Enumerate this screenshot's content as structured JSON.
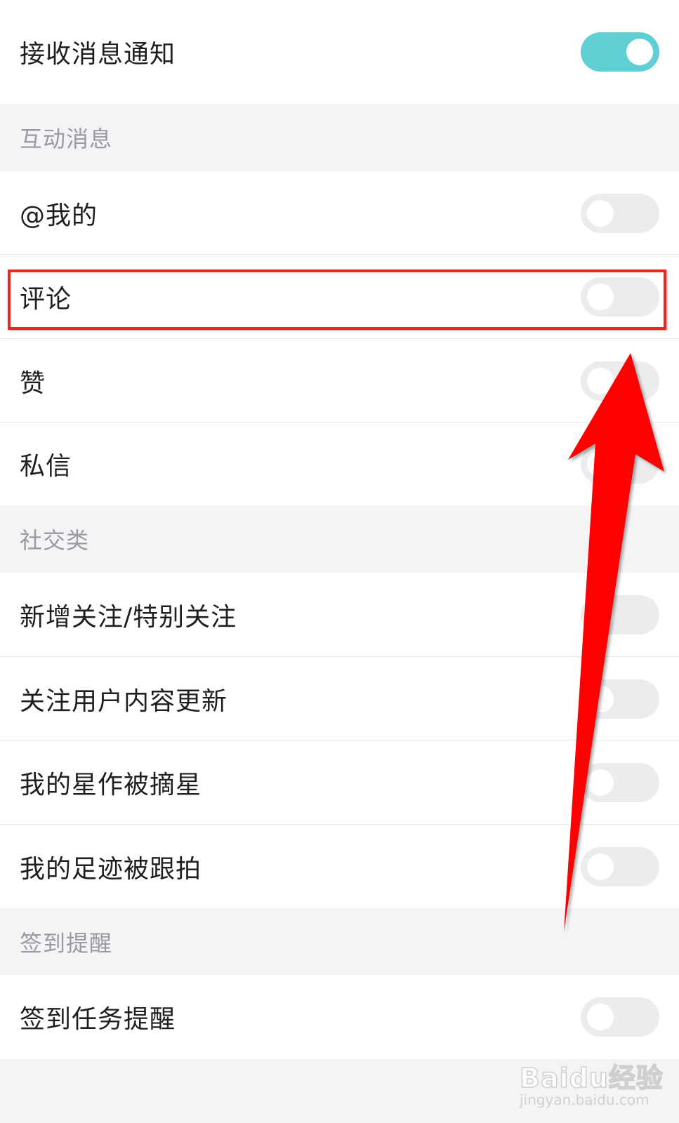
{
  "master_toggle": {
    "label": "接收消息通知",
    "on": true
  },
  "sections": [
    {
      "title": "互动消息",
      "items": [
        {
          "label": "@我的",
          "on": false
        },
        {
          "label": "评论",
          "on": false
        },
        {
          "label": "赞",
          "on": false
        },
        {
          "label": "私信",
          "on": false
        }
      ]
    },
    {
      "title": "社交类",
      "items": [
        {
          "label": "新增关注/特别关注",
          "on": false
        },
        {
          "label": "关注用户内容更新",
          "on": false
        },
        {
          "label": "我的星作被摘星",
          "on": false
        },
        {
          "label": "我的足迹被跟拍",
          "on": false
        }
      ]
    },
    {
      "title": "签到提醒",
      "items": [
        {
          "label": "签到任务提醒",
          "on": false
        }
      ]
    }
  ],
  "annotation": {
    "highlight_color": "#ee2424",
    "arrow_color": "#ff0000",
    "arrow_icon": "red-arrow-up"
  },
  "watermark": {
    "logo": "Baidu经验",
    "url": "jingyan.baidu.com"
  },
  "colors": {
    "toggle_on": "#5fcfd4",
    "toggle_off": "#ececef",
    "section_bg": "#f4f4f6"
  }
}
